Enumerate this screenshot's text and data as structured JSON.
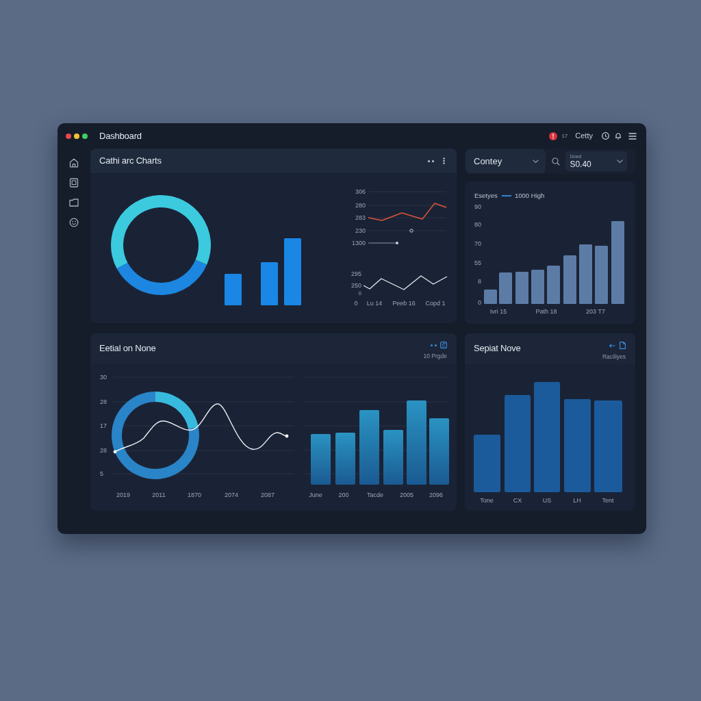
{
  "window": {
    "title": "Dashboard"
  },
  "top_bar": {
    "notification_count": "17",
    "user_name": "Cetty"
  },
  "overview_card": {
    "title": "Cathi arc Charts",
    "upper_line_chart": {
      "y_labels": [
        "306",
        "280",
        "283",
        "230",
        "1300"
      ]
    },
    "lower_line_chart": {
      "y_labels": [
        "295",
        "250",
        "0"
      ],
      "x_labels": [
        "0",
        "Lu 14",
        "Peeb 16",
        "Copd 1"
      ]
    }
  },
  "filter_bar": {
    "category_dropdown": {
      "value": "Contey"
    },
    "amount_field": {
      "label": "Dowd",
      "value": "S0.40"
    }
  },
  "series_card": {
    "legend": {
      "title": "Esetyes",
      "series": "1000 High"
    },
    "y_labels": [
      "90",
      "80",
      "70",
      "55",
      "8",
      "0"
    ],
    "x_labels": [
      "Ivri 15",
      "Path 18",
      "203 T7"
    ]
  },
  "detail_card": {
    "title": "Eetial on None",
    "subtitle": "10 Prgde",
    "line_chart": {
      "y_labels": [
        "30",
        "28",
        "17",
        "28",
        "5"
      ],
      "x_labels": [
        "2019",
        "2011",
        "1870",
        "2074",
        "2087"
      ]
    },
    "bar_chart": {
      "x_labels": [
        "June",
        "200",
        "Tacde",
        "2005",
        "2096"
      ]
    }
  },
  "summary_card": {
    "title": "Sepiat Nove",
    "subtitle": "Raciliyes",
    "x_labels": [
      "Tone",
      "CX",
      "US",
      "LH",
      "Tent"
    ]
  }
}
